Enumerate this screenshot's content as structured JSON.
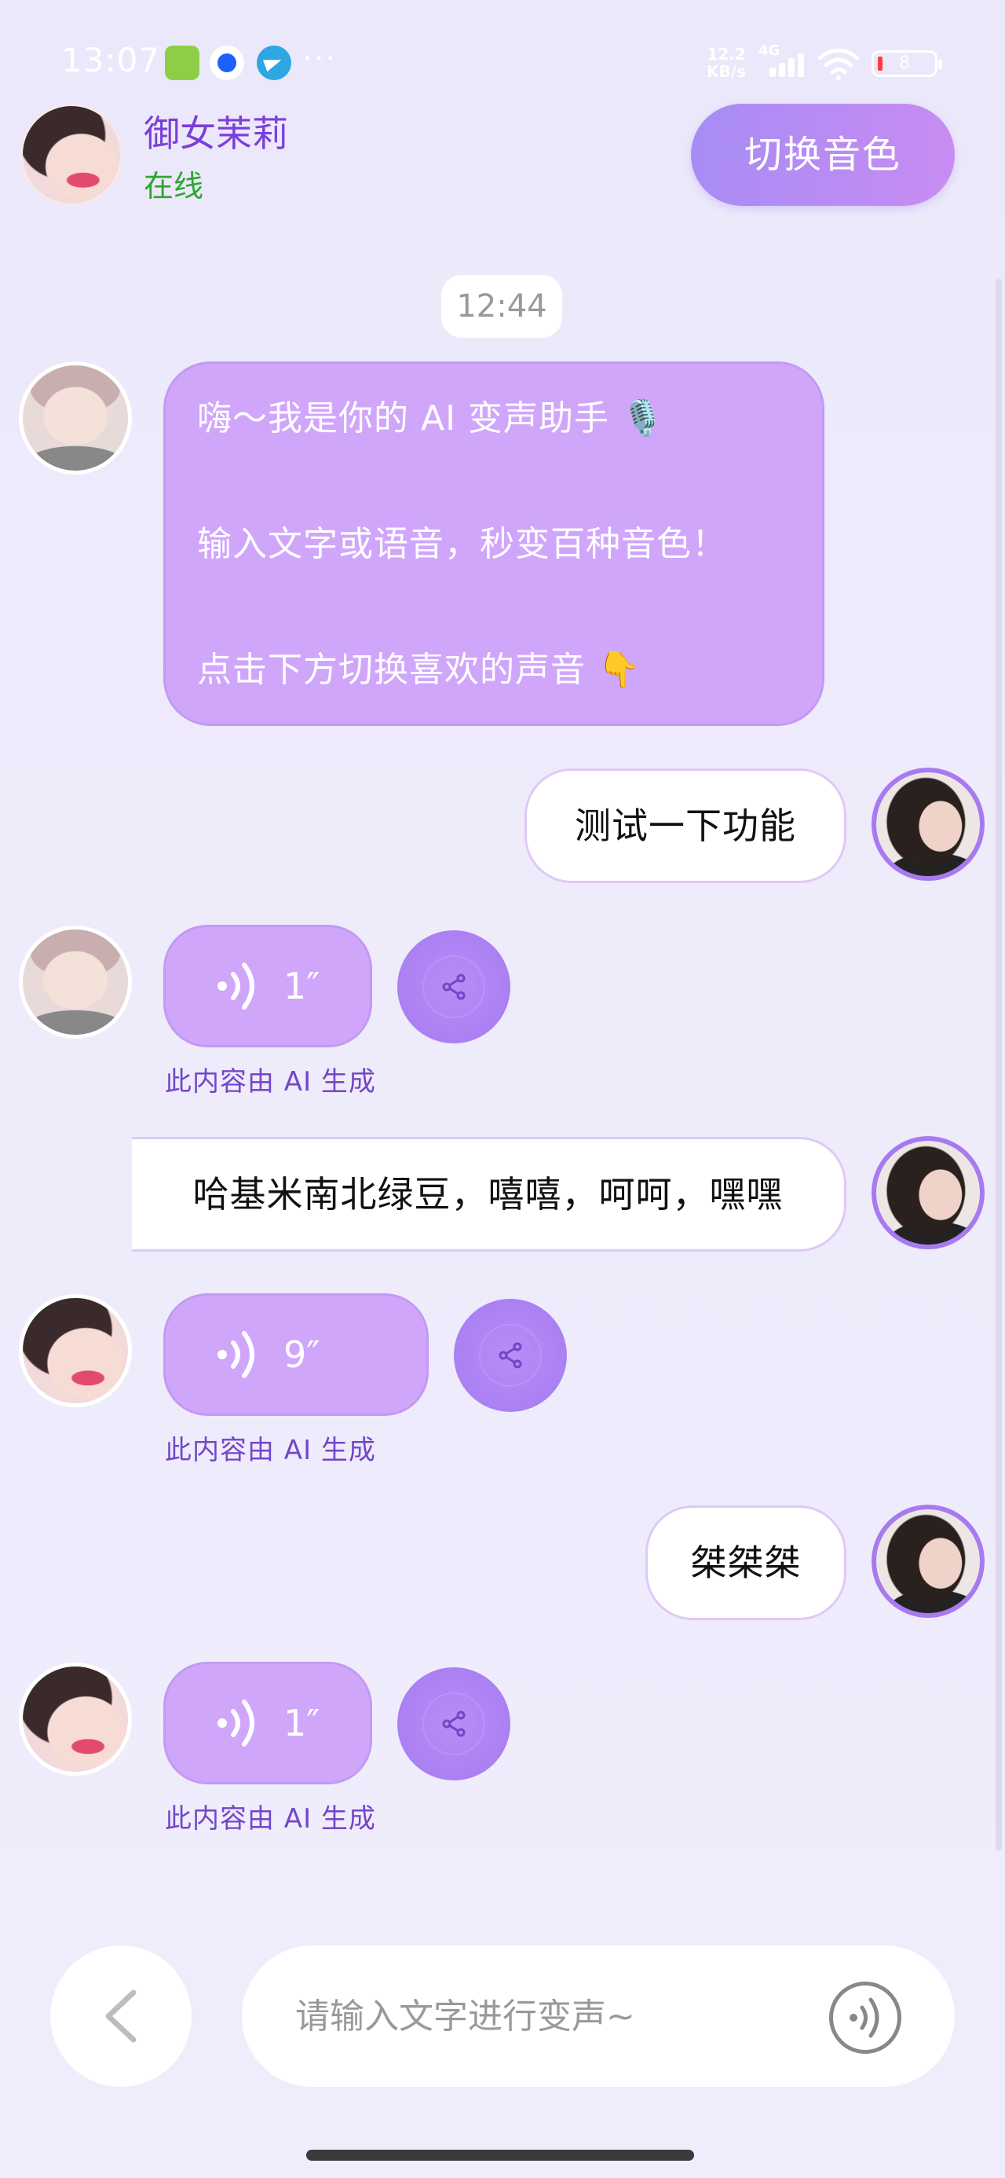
{
  "status_bar": {
    "time": "13:07",
    "more": "···",
    "net_speed": "12.2 KB/s",
    "network": "4G",
    "battery": "8",
    "icons": [
      "app-icon-green",
      "app-icon-blue-circle",
      "telegram-icon",
      "signal-icon",
      "wifi-icon",
      "battery-icon"
    ]
  },
  "header": {
    "name": "御女茉莉",
    "status": "在线",
    "switch_label": "切换音色"
  },
  "chat": {
    "timestamp": "12:44",
    "welcome": {
      "line1": "嗨～我是你的 AI 变声助手 🎙️",
      "line2": "输入文字或语音，秒变百种音色！",
      "line3": "点击下方切换喜欢的声音 👇"
    },
    "messages": [
      {
        "from": "user",
        "text": "测试一下功能"
      },
      {
        "from": "ai",
        "duration": "1″",
        "note": "此内容由 AI 生成"
      },
      {
        "from": "user",
        "text": "哈基米南北绿豆，嘻嘻，呵呵，嘿嘿"
      },
      {
        "from": "ai",
        "duration": "9″",
        "note": "此内容由 AI 生成"
      },
      {
        "from": "user",
        "text": "桀桀桀"
      },
      {
        "from": "ai",
        "duration": "1″",
        "note": "此内容由 AI 生成"
      }
    ]
  },
  "input": {
    "placeholder": "请输入文字进行变声~",
    "value": ""
  },
  "colors": {
    "accent": "#a77af0",
    "bubble": "#d0a6fb",
    "online": "#2ea52e",
    "name": "#7a3fd9"
  }
}
